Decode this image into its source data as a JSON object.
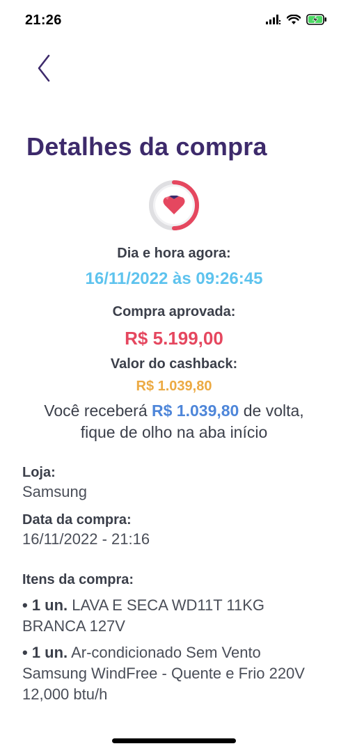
{
  "status_bar": {
    "time": "21:26"
  },
  "header": {
    "title": "Detalhes da compra"
  },
  "now": {
    "label": "Dia e hora agora:",
    "value": "16/11/2022 às 09:26:45"
  },
  "purchase": {
    "label": "Compra aprovada:",
    "amount": "R$ 5.199,00"
  },
  "cashback": {
    "label": "Valor do cashback:",
    "amount": "R$ 1.039,80",
    "message_prefix": "Você receberá ",
    "message_amount": "R$ 1.039,80",
    "message_suffix": " de volta,",
    "message_line2": "fique de olho na aba início"
  },
  "store": {
    "label": "Loja:",
    "value": "Samsung"
  },
  "purchase_date": {
    "label": "Data da compra:",
    "value": "16/11/2022 - 21:16"
  },
  "items": {
    "label": "Itens da compra:",
    "list": [
      {
        "bullet": "• ",
        "qty": "1 un.",
        "desc": " LAVA E SECA WD11T 11KG BRANCA 127V"
      },
      {
        "bullet": "• ",
        "qty": "1 un.",
        "desc": " Ar-condicionado Sem Vento Samsung WindFree - Quente e Frio 220V 12,000 btu/h"
      }
    ]
  },
  "colors": {
    "title": "#3d2a6b",
    "datetime": "#5ec3ee",
    "amount": "#e5475f",
    "cashback": "#ecaa43",
    "highlight": "#4e86d9",
    "battery": "#4cd964"
  },
  "icons": {
    "back": "chevron-left-icon",
    "badge": "heart-gem-icon",
    "signal": "signal-icon",
    "wifi": "wifi-icon",
    "battery": "battery-charging-icon"
  }
}
